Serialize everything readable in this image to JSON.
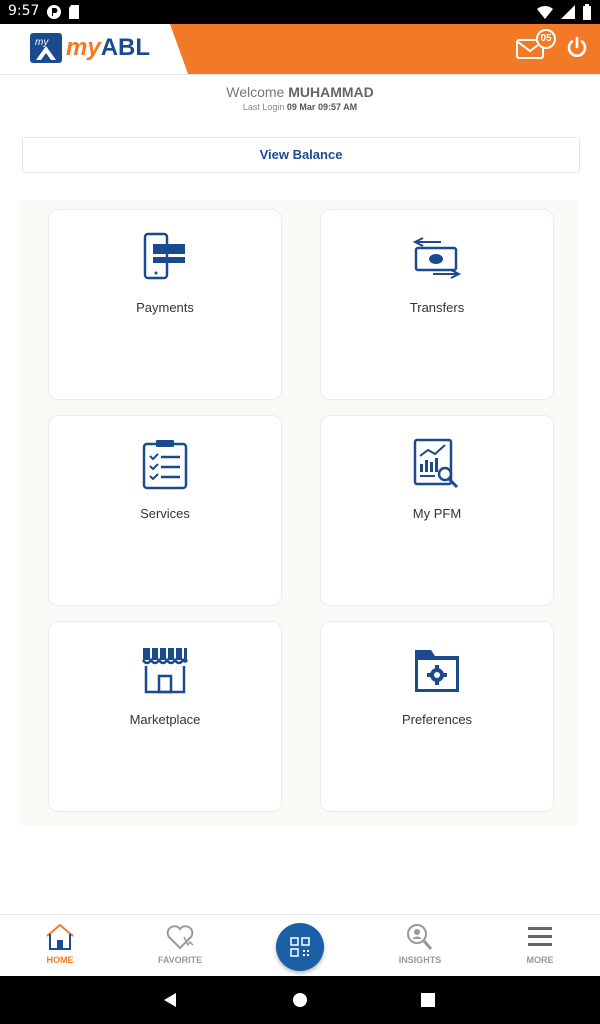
{
  "status_bar": {
    "time": "9:57"
  },
  "header": {
    "logo_my": "my",
    "logo_abl": "ABL",
    "mail_badge": "05"
  },
  "welcome": {
    "greeting": "Welcome",
    "name": "MUHAMMAD",
    "last_login_label": "Last Login",
    "last_login_value": "09 Mar 09:57 AM"
  },
  "view_balance": {
    "label": "View Balance"
  },
  "tiles": [
    {
      "label": "Payments"
    },
    {
      "label": "Transfers"
    },
    {
      "label": "Services"
    },
    {
      "label": "My PFM"
    },
    {
      "label": "Marketplace"
    },
    {
      "label": "Preferences"
    }
  ],
  "bottom_nav": {
    "items": [
      {
        "label": "HOME"
      },
      {
        "label": "FAVORITE"
      },
      {
        "label": "INSIGHTS"
      },
      {
        "label": "MORE"
      }
    ]
  },
  "colors": {
    "accent": "#f27a27",
    "brand": "#1b4b8f"
  }
}
